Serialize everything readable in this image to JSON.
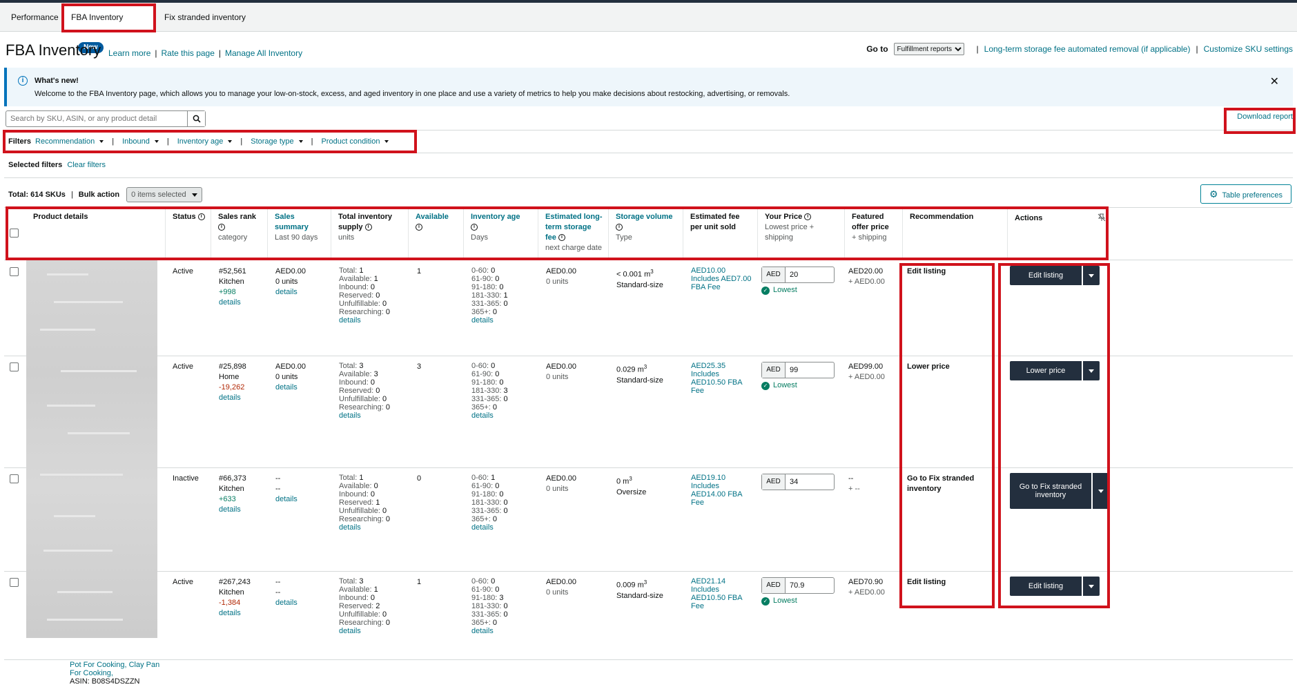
{
  "tabs": [
    {
      "label": "Performance"
    },
    {
      "label": "FBA Inventory",
      "badge": "New"
    },
    {
      "label": "Fix stranded inventory"
    }
  ],
  "header": {
    "title": "FBA Inventory",
    "links": [
      "Learn more",
      "Rate this page",
      "Manage All Inventory"
    ],
    "goto_label": "Go to",
    "goto_select": "Fulfillment reports",
    "right_links": [
      "Long-term storage fee automated removal (if applicable)",
      "Customize SKU settings"
    ]
  },
  "whats_new": {
    "title": "What's new!",
    "message": "Welcome to the FBA Inventory page, which allows you to manage your low-on-stock, excess, and aged inventory in one place and use a variety of metrics to help you make decisions about restocking, advertising, or removals."
  },
  "search": {
    "placeholder": "Search by SKU, ASIN, or any product detail"
  },
  "download_report": "Download report",
  "filters": {
    "label": "Filters",
    "items": [
      "Recommendation",
      "Inbound",
      "Inventory age",
      "Storage type",
      "Product condition"
    ]
  },
  "selected_filters": {
    "label": "Selected filters",
    "clear": "Clear filters"
  },
  "totals": {
    "total": "Total: 614 SKUs",
    "bulk_action": "Bulk action",
    "bulk_select": "0 items selected"
  },
  "table_preferences": "Table preferences",
  "columns": {
    "product_details": "Product details",
    "status": "Status",
    "sales_rank": "Sales rank",
    "sales_rank_sub": "category",
    "sales_summary": "Sales summary",
    "sales_summary_sub": "Last 90 days",
    "total_supply": "Total inventory supply",
    "total_supply_sub": "units",
    "available": "Available",
    "inventory_age": "Inventory age",
    "inventory_age_sub": "Days",
    "lt_fee_1": "Estimated long-",
    "lt_fee_2": "term storage",
    "lt_fee_3": "fee",
    "lt_fee_sub": "next charge date",
    "storage_volume": "Storage volume",
    "storage_volume_sub": "Type",
    "est_fee": "Estimated fee per unit sold",
    "your_price": "Your Price",
    "your_price_sub": "Lowest price + shipping",
    "featured_offer": "Featured offer price",
    "featured_offer_sub": "+ shipping",
    "recommendation": "Recommendation",
    "actions": "Actions"
  },
  "rows": [
    {
      "status": "Active",
      "rank": "#52,561",
      "category": "Kitchen",
      "rank_change": "+998",
      "rank_dir": "up",
      "sales": "AED0.00",
      "units": "0 units",
      "supply": {
        "total": "1",
        "available": "1",
        "inbound": "0",
        "reserved": "0",
        "unfulfillable": "0",
        "researching": "0"
      },
      "available": "1",
      "age": {
        "a0_60": "0",
        "a61_90": "0",
        "a91_180": "0",
        "a181_330": "1",
        "a331_365": "0",
        "a365": "0"
      },
      "lt_fee": "AED0.00",
      "lt_units": "0 units",
      "volume": "< 0.001 m",
      "size": "Standard-size",
      "fee1": "AED10.00",
      "fee2": "Includes AED7.00",
      "fee3": "FBA Fee",
      "price_cur": "AED",
      "price": "20",
      "lowest": "Lowest",
      "featured": "AED20.00",
      "featured_ship": "+ AED0.00",
      "recommendation": "Edit listing",
      "action": "Edit listing"
    },
    {
      "status": "Active",
      "rank": "#25,898",
      "category": "Home",
      "rank_change": "-19,262",
      "rank_dir": "down",
      "sales": "AED0.00",
      "units": "0 units",
      "supply": {
        "total": "3",
        "available": "3",
        "inbound": "0",
        "reserved": "0",
        "unfulfillable": "0",
        "researching": "0"
      },
      "available": "3",
      "age": {
        "a0_60": "0",
        "a61_90": "0",
        "a91_180": "0",
        "a181_330": "3",
        "a331_365": "0",
        "a365": "0"
      },
      "lt_fee": "AED0.00",
      "lt_units": "0 units",
      "volume": "0.029 m",
      "size": "Standard-size",
      "fee1": "AED25.35",
      "fee2": "Includes",
      "fee3": "AED10.50 FBA Fee",
      "price_cur": "AED",
      "price": "99",
      "lowest": "Lowest",
      "featured": "AED99.00",
      "featured_ship": "+ AED0.00",
      "recommendation": "Lower price",
      "action": "Lower price"
    },
    {
      "status": "Inactive",
      "rank": "#66,373",
      "category": "Kitchen",
      "rank_change": "+633",
      "rank_dir": "up",
      "sales": "--",
      "units": "--",
      "supply": {
        "total": "1",
        "available": "0",
        "inbound": "0",
        "reserved": "1",
        "unfulfillable": "0",
        "researching": "0"
      },
      "available": "0",
      "age": {
        "a0_60": "1",
        "a61_90": "0",
        "a91_180": "0",
        "a181_330": "0",
        "a331_365": "0",
        "a365": "0"
      },
      "lt_fee": "AED0.00",
      "lt_units": "0 units",
      "volume": "0 m",
      "size": "Oversize",
      "fee1": "AED19.10",
      "fee2": "Includes",
      "fee3": "AED14.00 FBA Fee",
      "price_cur": "AED",
      "price": "34",
      "lowest": "",
      "featured": "--",
      "featured_ship": "+ --",
      "recommendation": "Go to Fix stranded inventory",
      "action": "Go to Fix stranded inventory"
    },
    {
      "status": "Active",
      "rank": "#267,243",
      "category": "Kitchen",
      "rank_change": "-1,384",
      "rank_dir": "down",
      "sales": "--",
      "units": "--",
      "supply": {
        "total": "3",
        "available": "1",
        "inbound": "0",
        "reserved": "2",
        "unfulfillable": "0",
        "researching": "0"
      },
      "available": "1",
      "age": {
        "a0_60": "0",
        "a61_90": "0",
        "a91_180": "3",
        "a181_330": "0",
        "a331_365": "0",
        "a365": "0"
      },
      "lt_fee": "AED0.00",
      "lt_units": "0 units",
      "volume": "0.009 m",
      "size": "Standard-size",
      "fee1": "AED21.14",
      "fee2": "Includes",
      "fee3": "AED10.50 FBA Fee",
      "price_cur": "AED",
      "price": "70.9",
      "lowest": "Lowest",
      "featured": "AED70.90",
      "featured_ship": "+ AED0.00",
      "recommendation": "Edit listing",
      "action": "Edit listing",
      "product_visible_1": "Pot For Cooking, Clay Pan",
      "product_visible_2": "For Cooking,",
      "product_visible_3": "ASIN: B08S4DSZZN"
    }
  ],
  "labels": {
    "details": "details",
    "total": "Total:",
    "available": "Available:",
    "inbound": "Inbound:",
    "reserved": "Reserved:",
    "unfulfillable": "Unfulfillable:",
    "researching": "Researching:",
    "age_0_60": "0-60:",
    "age_61_90": "61-90:",
    "age_91_180": "91-180:",
    "age_181_330": "181-330:",
    "age_331_365": "331-365:",
    "age_365": "365+:",
    "cubic": "3"
  },
  "colors": {
    "accent": "#007185",
    "highlight": "#d0121c",
    "button": "#232f3e",
    "positive": "#067d62",
    "negative": "#b12704"
  }
}
